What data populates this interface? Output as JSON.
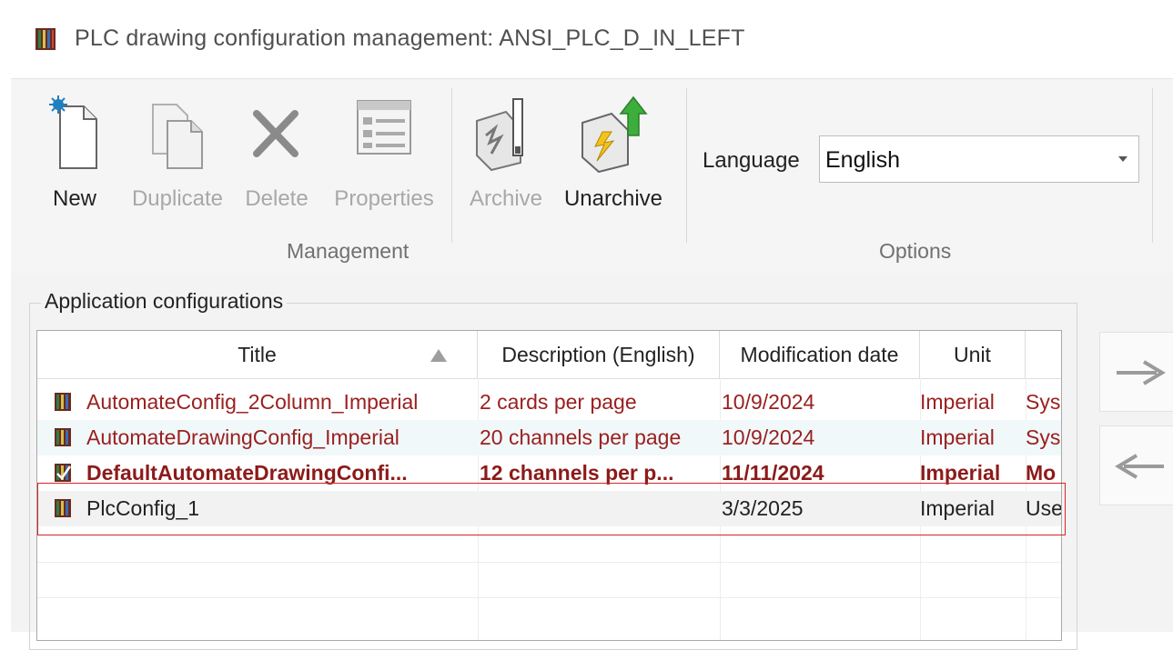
{
  "window": {
    "title": "PLC drawing configuration management: ANSI_PLC_D_IN_LEFT"
  },
  "ribbon": {
    "buttons": [
      {
        "label": "New",
        "enabled": true,
        "icon": "new-document-icon"
      },
      {
        "label": "Duplicate",
        "enabled": false,
        "icon": "duplicate-icon"
      },
      {
        "label": "Delete",
        "enabled": false,
        "icon": "delete-x-icon"
      },
      {
        "label": "Properties",
        "enabled": false,
        "icon": "properties-icon"
      },
      {
        "label": "Archive",
        "enabled": false,
        "icon": "archive-icon"
      },
      {
        "label": "Unarchive",
        "enabled": true,
        "icon": "unarchive-icon"
      }
    ],
    "groups": {
      "management": "Management",
      "options": "Options"
    },
    "language": {
      "label": "Language",
      "value": "English"
    }
  },
  "configs": {
    "group_label": "Application configurations",
    "columns": [
      "Title",
      "Description (English)",
      "Modification date",
      "Unit"
    ],
    "rows": [
      {
        "title": "AutomateConfig_2Column_Imperial",
        "description": "2 cards per page",
        "date": "10/9/2024",
        "unit": "Imperial",
        "extra": "Sys"
      },
      {
        "title": "AutomateDrawingConfig_Imperial",
        "description": "20 channels per page",
        "date": "10/9/2024",
        "unit": "Imperial",
        "extra": "Sys"
      },
      {
        "title": "DefaultAutomateDrawingConfi...",
        "description": "12 channels per p...",
        "date": "11/11/2024",
        "unit": "Imperial",
        "extra": "Mo"
      },
      {
        "title": "PlcConfig_1",
        "description": "",
        "date": "3/3/2025",
        "unit": "Imperial",
        "extra": "Use"
      }
    ]
  },
  "colors": {
    "row_text": "#9a2020",
    "highlight_box": "#d62424",
    "unarchive_arrow": "#3cae3c"
  }
}
